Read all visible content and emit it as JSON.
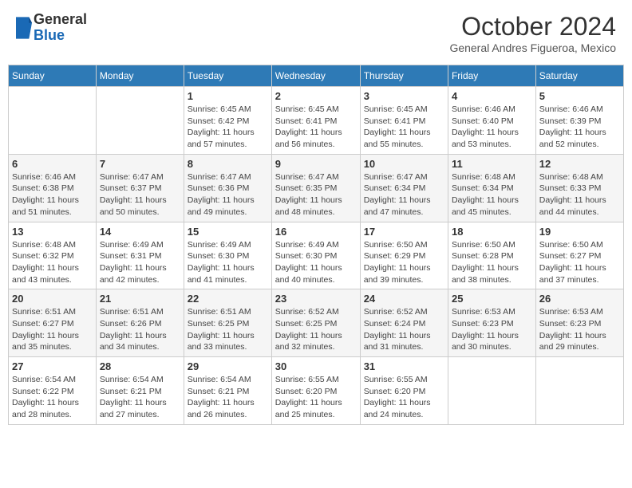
{
  "logo": {
    "general": "General",
    "blue": "Blue"
  },
  "header": {
    "month": "October 2024",
    "location": "General Andres Figueroa, Mexico"
  },
  "days_of_week": [
    "Sunday",
    "Monday",
    "Tuesday",
    "Wednesday",
    "Thursday",
    "Friday",
    "Saturday"
  ],
  "weeks": [
    [
      {
        "day": "",
        "info": ""
      },
      {
        "day": "",
        "info": ""
      },
      {
        "day": "1",
        "info": "Sunrise: 6:45 AM\nSunset: 6:42 PM\nDaylight: 11 hours and 57 minutes."
      },
      {
        "day": "2",
        "info": "Sunrise: 6:45 AM\nSunset: 6:41 PM\nDaylight: 11 hours and 56 minutes."
      },
      {
        "day": "3",
        "info": "Sunrise: 6:45 AM\nSunset: 6:41 PM\nDaylight: 11 hours and 55 minutes."
      },
      {
        "day": "4",
        "info": "Sunrise: 6:46 AM\nSunset: 6:40 PM\nDaylight: 11 hours and 53 minutes."
      },
      {
        "day": "5",
        "info": "Sunrise: 6:46 AM\nSunset: 6:39 PM\nDaylight: 11 hours and 52 minutes."
      }
    ],
    [
      {
        "day": "6",
        "info": "Sunrise: 6:46 AM\nSunset: 6:38 PM\nDaylight: 11 hours and 51 minutes."
      },
      {
        "day": "7",
        "info": "Sunrise: 6:47 AM\nSunset: 6:37 PM\nDaylight: 11 hours and 50 minutes."
      },
      {
        "day": "8",
        "info": "Sunrise: 6:47 AM\nSunset: 6:36 PM\nDaylight: 11 hours and 49 minutes."
      },
      {
        "day": "9",
        "info": "Sunrise: 6:47 AM\nSunset: 6:35 PM\nDaylight: 11 hours and 48 minutes."
      },
      {
        "day": "10",
        "info": "Sunrise: 6:47 AM\nSunset: 6:34 PM\nDaylight: 11 hours and 47 minutes."
      },
      {
        "day": "11",
        "info": "Sunrise: 6:48 AM\nSunset: 6:34 PM\nDaylight: 11 hours and 45 minutes."
      },
      {
        "day": "12",
        "info": "Sunrise: 6:48 AM\nSunset: 6:33 PM\nDaylight: 11 hours and 44 minutes."
      }
    ],
    [
      {
        "day": "13",
        "info": "Sunrise: 6:48 AM\nSunset: 6:32 PM\nDaylight: 11 hours and 43 minutes."
      },
      {
        "day": "14",
        "info": "Sunrise: 6:49 AM\nSunset: 6:31 PM\nDaylight: 11 hours and 42 minutes."
      },
      {
        "day": "15",
        "info": "Sunrise: 6:49 AM\nSunset: 6:30 PM\nDaylight: 11 hours and 41 minutes."
      },
      {
        "day": "16",
        "info": "Sunrise: 6:49 AM\nSunset: 6:30 PM\nDaylight: 11 hours and 40 minutes."
      },
      {
        "day": "17",
        "info": "Sunrise: 6:50 AM\nSunset: 6:29 PM\nDaylight: 11 hours and 39 minutes."
      },
      {
        "day": "18",
        "info": "Sunrise: 6:50 AM\nSunset: 6:28 PM\nDaylight: 11 hours and 38 minutes."
      },
      {
        "day": "19",
        "info": "Sunrise: 6:50 AM\nSunset: 6:27 PM\nDaylight: 11 hours and 37 minutes."
      }
    ],
    [
      {
        "day": "20",
        "info": "Sunrise: 6:51 AM\nSunset: 6:27 PM\nDaylight: 11 hours and 35 minutes."
      },
      {
        "day": "21",
        "info": "Sunrise: 6:51 AM\nSunset: 6:26 PM\nDaylight: 11 hours and 34 minutes."
      },
      {
        "day": "22",
        "info": "Sunrise: 6:51 AM\nSunset: 6:25 PM\nDaylight: 11 hours and 33 minutes."
      },
      {
        "day": "23",
        "info": "Sunrise: 6:52 AM\nSunset: 6:25 PM\nDaylight: 11 hours and 32 minutes."
      },
      {
        "day": "24",
        "info": "Sunrise: 6:52 AM\nSunset: 6:24 PM\nDaylight: 11 hours and 31 minutes."
      },
      {
        "day": "25",
        "info": "Sunrise: 6:53 AM\nSunset: 6:23 PM\nDaylight: 11 hours and 30 minutes."
      },
      {
        "day": "26",
        "info": "Sunrise: 6:53 AM\nSunset: 6:23 PM\nDaylight: 11 hours and 29 minutes."
      }
    ],
    [
      {
        "day": "27",
        "info": "Sunrise: 6:54 AM\nSunset: 6:22 PM\nDaylight: 11 hours and 28 minutes."
      },
      {
        "day": "28",
        "info": "Sunrise: 6:54 AM\nSunset: 6:21 PM\nDaylight: 11 hours and 27 minutes."
      },
      {
        "day": "29",
        "info": "Sunrise: 6:54 AM\nSunset: 6:21 PM\nDaylight: 11 hours and 26 minutes."
      },
      {
        "day": "30",
        "info": "Sunrise: 6:55 AM\nSunset: 6:20 PM\nDaylight: 11 hours and 25 minutes."
      },
      {
        "day": "31",
        "info": "Sunrise: 6:55 AM\nSunset: 6:20 PM\nDaylight: 11 hours and 24 minutes."
      },
      {
        "day": "",
        "info": ""
      },
      {
        "day": "",
        "info": ""
      }
    ]
  ]
}
